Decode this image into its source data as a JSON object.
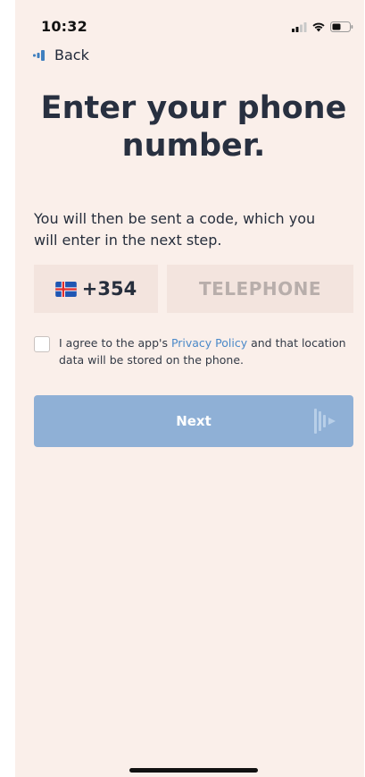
{
  "status_bar": {
    "time": "10:32"
  },
  "nav": {
    "back_label": "Back"
  },
  "page": {
    "title": "Enter your phone number.",
    "subtitle": "You will then be sent a code, which you will enter in the next step."
  },
  "phone": {
    "country_code": "+354",
    "country_flag": "iceland-flag-icon",
    "placeholder": "TELEPHONE",
    "value": ""
  },
  "consent": {
    "checked": false,
    "text_before": "I agree to the app's ",
    "link_text": "Privacy Policy",
    "text_after": " and that location data will be stored on the phone."
  },
  "actions": {
    "next_label": "Next",
    "next_icon": "play-audio-icon"
  },
  "colors": {
    "background": "#faefea",
    "input_background": "#f3e4de",
    "button": "#8fb0d6",
    "link": "#4b89c8",
    "heading": "#283040"
  }
}
